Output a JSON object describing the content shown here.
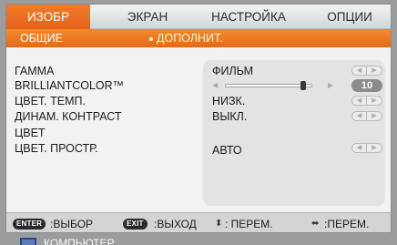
{
  "tabs": [
    {
      "label": "ИЗОБР",
      "active": true
    },
    {
      "label": "ЭКРАН",
      "active": false
    },
    {
      "label": "НАСТРОЙКА",
      "active": false
    },
    {
      "label": "ОПЦИИ",
      "active": false
    }
  ],
  "subtabs": [
    {
      "label": "ОБЩИЕ",
      "active": false
    },
    {
      "label": "ДОПОЛНИТ.",
      "active": true
    }
  ],
  "settings": [
    {
      "label": "ГАММА",
      "value": "ФИЛЬМ",
      "control": "arrows"
    },
    {
      "label": "BRILLIANTCOLOR™",
      "value": "10",
      "control": "slider",
      "slider_fraction": 0.9
    },
    {
      "label": "ЦВЕТ. ТЕМП.",
      "value": "НИЗК.",
      "control": "arrows"
    },
    {
      "label": "ДИНАМ. КОНТРАСТ",
      "value": "ВЫКЛ.",
      "control": "arrows"
    },
    {
      "label": "ЦВЕТ",
      "value": "",
      "control": "none"
    },
    {
      "label": "ЦВЕТ. ПРОСТР.",
      "value": "АВТО",
      "control": "arrows"
    }
  ],
  "footer": {
    "enter_badge": "ENTER",
    "enter_label": ":ВЫБОР",
    "exit_badge": "EXIT",
    "exit_label": ":ВЫХОД",
    "updown_label": ": ПЕРЕМ.",
    "leftright_label": ":ПЕРЕМ."
  },
  "source_bar": {
    "label": "КОМПЬЮТЕР"
  },
  "icons": {
    "left_arrow": "◀",
    "right_arrow": "▶",
    "updown": "⬍",
    "leftright": "⬌"
  },
  "colors": {
    "accent_orange": "#e8701f",
    "panel_gray": "#e2e3e4",
    "footer_gray": "#d2d4d6"
  }
}
